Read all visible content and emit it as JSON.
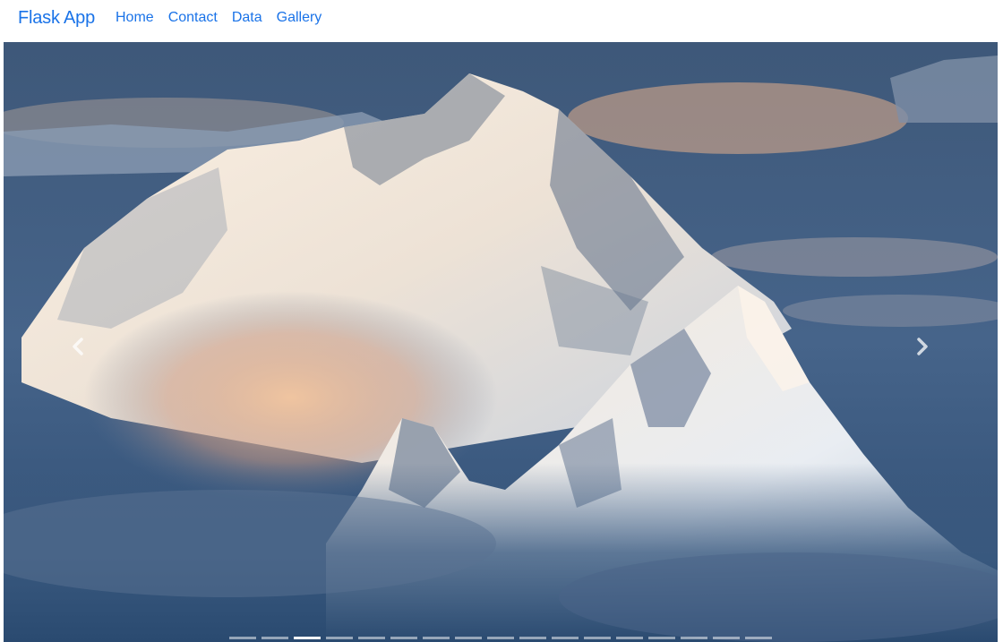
{
  "navbar": {
    "brand": "Flask App",
    "links": [
      {
        "label": "Home"
      },
      {
        "label": "Contact"
      },
      {
        "label": "Data"
      },
      {
        "label": "Gallery"
      }
    ]
  },
  "carousel": {
    "indicator_count": 17,
    "active_index": 2,
    "prev_icon": "chevron-left-icon",
    "next_icon": "chevron-right-icon",
    "slide_image": "snow-capped-mountain-peak-at-sunset-photo"
  },
  "colors": {
    "link": "#1a73e8",
    "sky": "#3a5675",
    "snow": "#f3ece4",
    "glow": "#e8b48a",
    "rock_shadow": "#5a6f88"
  }
}
